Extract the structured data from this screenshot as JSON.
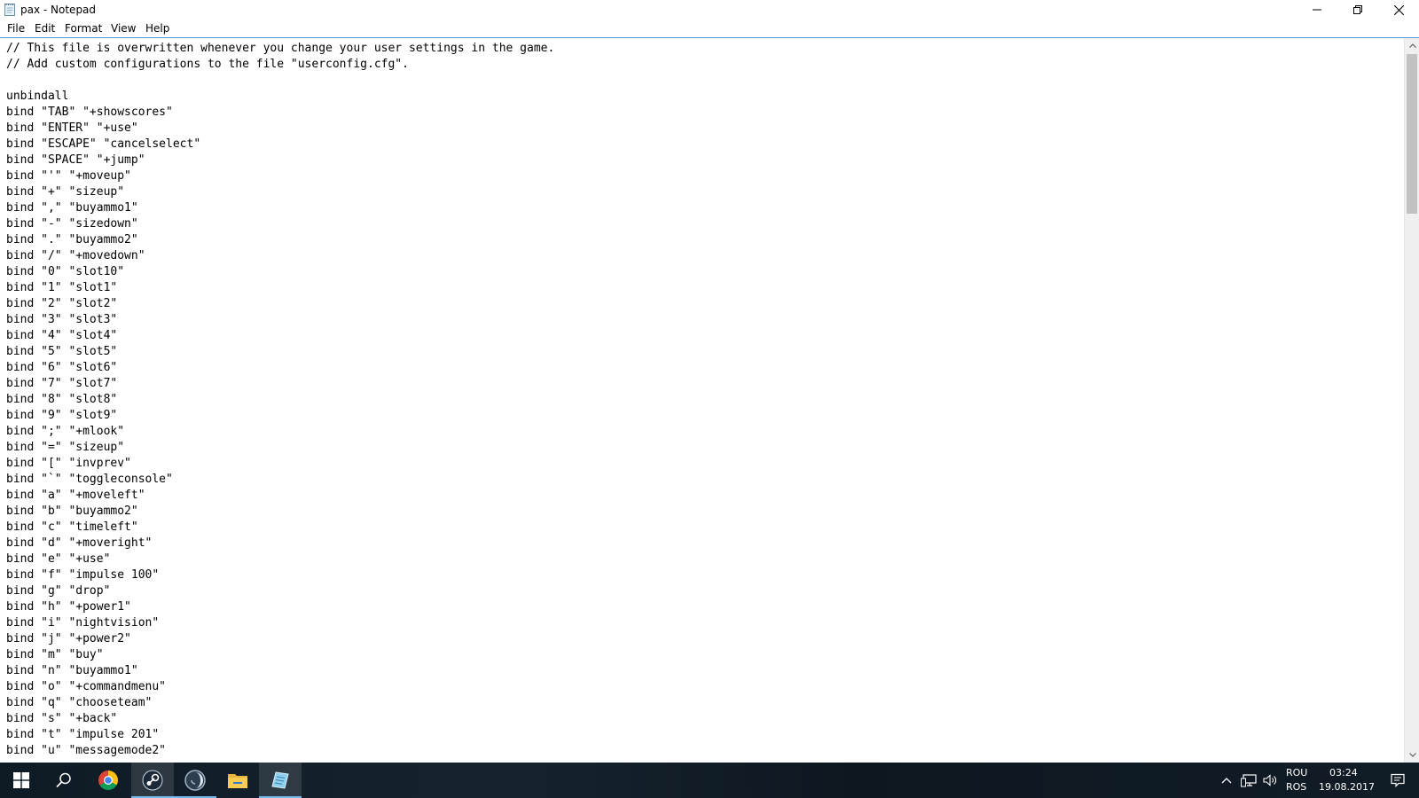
{
  "window": {
    "title": "pax - Notepad",
    "menu": [
      "File",
      "Edit",
      "Format",
      "View",
      "Help"
    ]
  },
  "editor": {
    "lines": [
      "// This file is overwritten whenever you change your user settings in the game.",
      "// Add custom configurations to the file \"userconfig.cfg\".",
      "",
      "unbindall",
      "bind \"TAB\" \"+showscores\"",
      "bind \"ENTER\" \"+use\"",
      "bind \"ESCAPE\" \"cancelselect\"",
      "bind \"SPACE\" \"+jump\"",
      "bind \"'\" \"+moveup\"",
      "bind \"+\" \"sizeup\"",
      "bind \",\" \"buyammo1\"",
      "bind \"-\" \"sizedown\"",
      "bind \".\" \"buyammo2\"",
      "bind \"/\" \"+movedown\"",
      "bind \"0\" \"slot10\"",
      "bind \"1\" \"slot1\"",
      "bind \"2\" \"slot2\"",
      "bind \"3\" \"slot3\"",
      "bind \"4\" \"slot4\"",
      "bind \"5\" \"slot5\"",
      "bind \"6\" \"slot6\"",
      "bind \"7\" \"slot7\"",
      "bind \"8\" \"slot8\"",
      "bind \"9\" \"slot9\"",
      "bind \";\" \"+mlook\"",
      "bind \"=\" \"sizeup\"",
      "bind \"[\" \"invprev\"",
      "bind \"`\" \"toggleconsole\"",
      "bind \"a\" \"+moveleft\"",
      "bind \"b\" \"buyammo2\"",
      "bind \"c\" \"timeleft\"",
      "bind \"d\" \"+moveright\"",
      "bind \"e\" \"+use\"",
      "bind \"f\" \"impulse 100\"",
      "bind \"g\" \"drop\"",
      "bind \"h\" \"+power1\"",
      "bind \"i\" \"nightvision\"",
      "bind \"j\" \"+power2\"",
      "bind \"m\" \"buy\"",
      "bind \"n\" \"buyammo1\"",
      "bind \"o\" \"+commandmenu\"",
      "bind \"q\" \"chooseteam\"",
      "bind \"s\" \"+back\"",
      "bind \"t\" \"impulse 201\"",
      "bind \"u\" \"messagemode2\""
    ]
  },
  "taskbar": {
    "apps": [
      {
        "name": "start",
        "icon": "windows-logo-icon"
      },
      {
        "name": "search",
        "icon": "search-icon"
      },
      {
        "name": "chrome",
        "icon": "chrome-icon"
      },
      {
        "name": "steam",
        "icon": "steam-icon"
      },
      {
        "name": "app-dark",
        "icon": "half-moon-app-icon"
      },
      {
        "name": "file-explorer",
        "icon": "folder-icon"
      },
      {
        "name": "notepad",
        "icon": "notepad-icon"
      }
    ],
    "tray": {
      "lang_top": "ROU",
      "lang_bottom": "ROS",
      "time": "03:24",
      "date": "19.08.2017"
    }
  },
  "colors": {
    "accent": "#5b9bd5",
    "taskbar": "#101c26",
    "text": "#000000"
  }
}
